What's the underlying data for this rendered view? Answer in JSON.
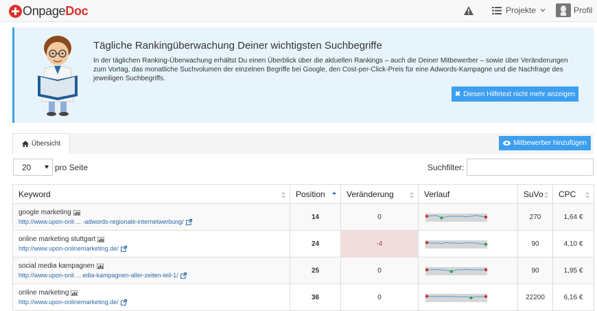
{
  "header": {
    "logo_part1": "Onpage",
    "logo_part2": "Doc",
    "projects_label": "Projekte",
    "profile_label": "Profil"
  },
  "help": {
    "title": "Tägliche Rankingüberwachung Deiner wichtigsten Suchbegriffe",
    "text": "In der täglichen Ranking-Überwachung erhältst Du einen Überblick über die aktuellen Rankings – auch die Deiner Mitbewerber – sowie über Veränderungen zum Vortag, das monatliche Suchvolumen der einzelnen Begriffe bei Google, den Cost-per-Click-Preis für eine Adwords-Kampagne und die Nachfrage des jeweiligen Suchbegriffs.",
    "hide_button": "Diesen Hilfetext nicht mehr anzeigen",
    "hide_icon": "close-icon"
  },
  "tabs": {
    "overview": "Übersicht",
    "add_competitor": "Mitbewerber hinzufügen"
  },
  "controls": {
    "per_page_value": "20",
    "per_page_label": "pro Seite",
    "filter_label": "Suchfilter:",
    "filter_value": ""
  },
  "table": {
    "headers": {
      "keyword": "Keyword",
      "position": "Position",
      "change": "Veränderung",
      "trend": "Verlauf",
      "volume": "SuVo",
      "cpc": "CPC"
    },
    "rows": [
      {
        "keyword": "google marketing",
        "url": "http://www.upon-onli ... -adwords-regionale-internetwerbung/",
        "position": "14",
        "change": "0",
        "volume": "270",
        "cpc": "1,64 €",
        "trend": [
          0.5,
          0.55,
          0.6,
          0.3,
          0.45,
          0.5,
          0.5,
          0.5,
          0.45,
          0.5,
          0.6,
          0.5,
          0.4
        ]
      },
      {
        "keyword": "online marketing stuttgart",
        "url": "http://www.upon-onlinemarketing.de/",
        "position": "24",
        "change": "-4",
        "volume": "90",
        "cpc": "4,10 €",
        "trend": [
          0.55,
          0.5,
          0.5,
          0.45,
          0.55,
          0.5,
          0.5,
          0.45,
          0.55,
          0.5,
          0.5,
          0.4,
          0.35
        ]
      },
      {
        "keyword": "social media kampagnen",
        "url": "http://www.upon-onli ... edia-kampagnen-aller-zeiten-teil-1/",
        "position": "25",
        "change": "0",
        "volume": "90",
        "cpc": "1,95 €",
        "trend": [
          0.5,
          0.5,
          0.55,
          0.5,
          0.45,
          0.3,
          0.5,
          0.5,
          0.55,
          0.5,
          0.5,
          0.5,
          0.5
        ]
      },
      {
        "keyword": "online marketing",
        "url": "http://www.upon-onlinemarketing.de/",
        "position": "36",
        "change": "0",
        "volume": "22200",
        "cpc": "6,16 €",
        "trend": [
          0.55,
          0.5,
          0.5,
          0.55,
          0.5,
          0.5,
          0.5,
          0.45,
          0.5,
          0.35,
          0.5,
          0.5,
          0.5
        ]
      }
    ]
  },
  "colors": {
    "brand_red": "#d9322c",
    "accent_blue": "#3c9ff0",
    "negative_bg": "#f2dede"
  }
}
